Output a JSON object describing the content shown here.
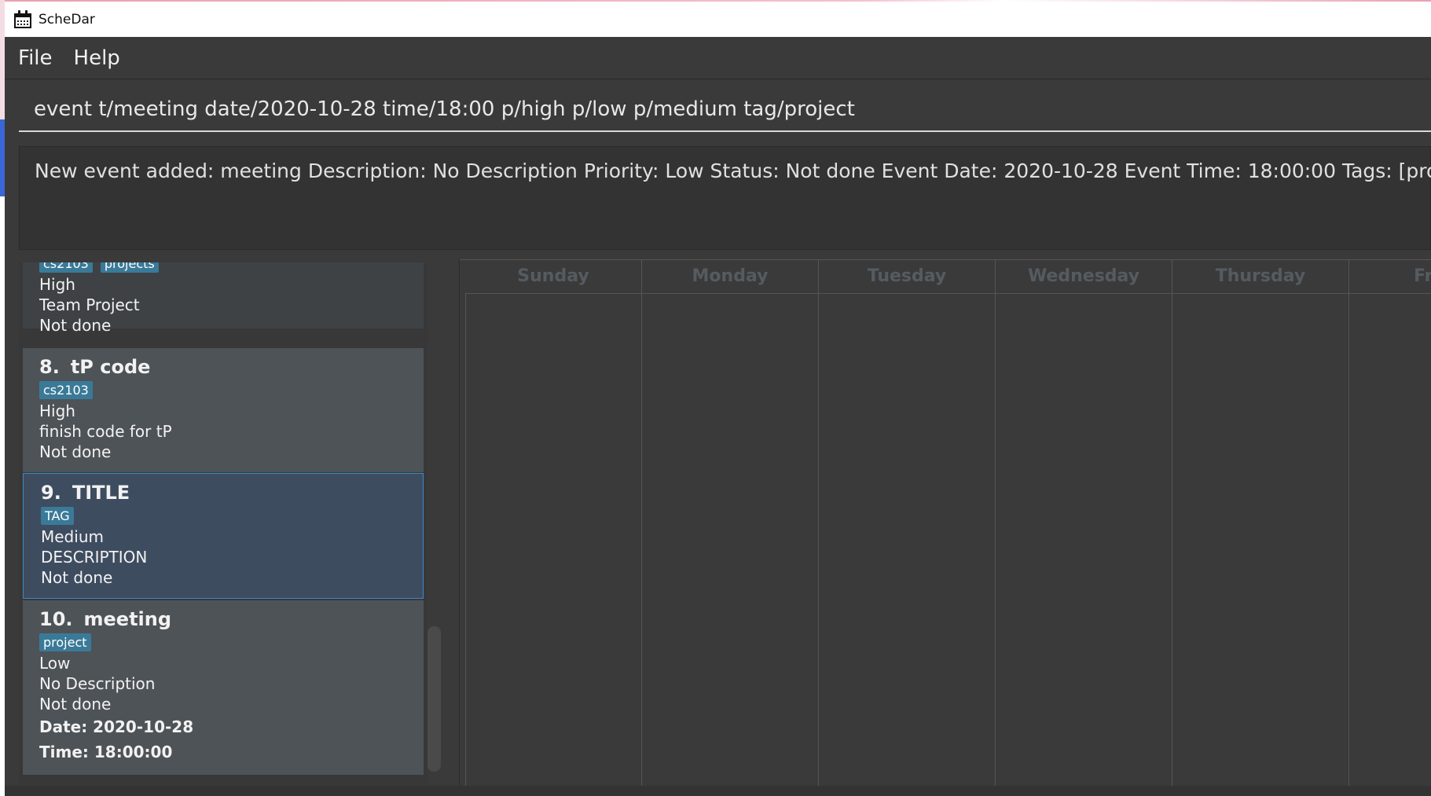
{
  "window": {
    "title": "ScheDar"
  },
  "menu": {
    "file": "File",
    "help": "Help"
  },
  "command": {
    "value": "event t/meeting date/2020-10-28 time/18:00 p/high p/low p/medium tag/project"
  },
  "result": {
    "text": "New event added: meeting Description: No Description Priority: Low Status: Not done Event Date: 2020-10-28 Event Time: 18:00:00 Tags: [project]"
  },
  "task_list": {
    "partial": {
      "tags": [
        "cs2103",
        "projects"
      ],
      "priority": "High",
      "description": "Team Project",
      "status": "Not done"
    },
    "items": [
      {
        "index": "8.",
        "title": "tP code",
        "tags": [
          "cs2103"
        ],
        "priority": "High",
        "description": "finish code for tP",
        "status": "Not done"
      },
      {
        "index": "9.",
        "title": "TITLE",
        "tags": [
          "TAG"
        ],
        "priority": "Medium",
        "description": "DESCRIPTION",
        "status": "Not done"
      },
      {
        "index": "10.",
        "title": "meeting",
        "tags": [
          "project"
        ],
        "priority": "Low",
        "description": "No Description",
        "status": "Not done",
        "date": "Date: 2020-10-28",
        "time": "Time: 18:00:00"
      }
    ]
  },
  "calendar": {
    "days": [
      "Sunday",
      "Monday",
      "Tuesday",
      "Wednesday",
      "Thursday",
      "Fri"
    ]
  },
  "colors": {
    "background": "#3a3a3a",
    "card": "#4e5358",
    "selected_card": "#3e4c60",
    "tag": "#3a7a98"
  }
}
